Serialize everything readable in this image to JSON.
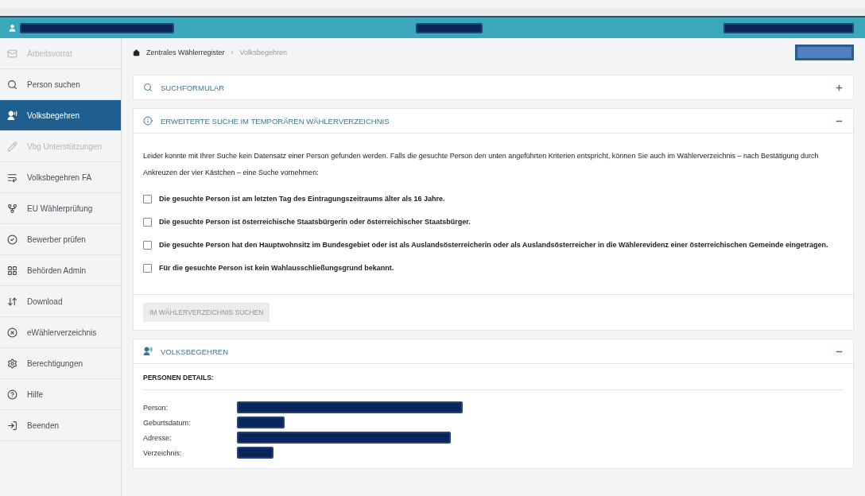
{
  "sidebar": {
    "items": [
      {
        "label": "Arbeitsvorrat",
        "selected": false,
        "disabled": true
      },
      {
        "label": "Person suchen",
        "selected": false,
        "disabled": false
      },
      {
        "label": "Volksbegehren",
        "selected": true,
        "disabled": false
      },
      {
        "label": "Vbg Unterstützungen",
        "selected": false,
        "disabled": true
      },
      {
        "label": "Volksbegehren FA",
        "selected": false,
        "disabled": false
      },
      {
        "label": "EU Wählerprüfung",
        "selected": false,
        "disabled": false
      },
      {
        "label": "Bewerber prüfen",
        "selected": false,
        "disabled": false
      },
      {
        "label": "Behörden Admin",
        "selected": false,
        "disabled": false
      },
      {
        "label": "Download",
        "selected": false,
        "disabled": false
      },
      {
        "label": "eWählerverzeichnis",
        "selected": false,
        "disabled": false
      },
      {
        "label": "Berechtigungen",
        "selected": false,
        "disabled": false
      },
      {
        "label": "Hilfe",
        "selected": false,
        "disabled": false
      },
      {
        "label": "Beenden",
        "selected": false,
        "disabled": false
      }
    ]
  },
  "breadcrumb": {
    "items": [
      "Zentrales Wählerregister",
      "Volksbegehren"
    ],
    "separator": "›"
  },
  "panels": [
    {
      "kind": "search",
      "title": "SUCHFORMULAR",
      "expanded": false
    },
    {
      "kind": "criteria",
      "title": "ERWEITERTE SUCHE IM TEMPORÄREN WÄHLERVERZEICHNIS",
      "expanded": true,
      "text": "Leider konnte mit Ihrer Suche kein Datensatz einer Person gefunden werden. Falls die gesuchte Person den unten angeführten Kriterien entspricht, können Sie auch im Wählerverzeichnis – nach Bestätigung durch Ankreuzen der vier Kästchen – eine Suche vornehmen:",
      "checks": [
        {
          "label": "Die gesuchte Person ist am letzten Tag des Eintragungszeitraums älter als 16 Jahre.",
          "checked": false
        },
        {
          "label": "Die gesuchte Person ist österreichische Staatsbürgerin oder österreichischer Staatsbürger.",
          "checked": false
        },
        {
          "label": "Die gesuchte Person hat den Hauptwohnsitz im Bundesgebiet oder ist als Auslandsösterreicherin oder als Auslandsösterreicher in die Wählerevidenz einer österreichischen Gemeinde eingetragen.",
          "checked": false
        },
        {
          "label": "Für die gesuchte Person ist kein Wahlausschließungsgrund bekannt.",
          "checked": false
        }
      ],
      "button": {
        "label": "IM WÄHLERVERZEICHNIS SUCHEN",
        "disabled": true
      }
    },
    {
      "kind": "details",
      "title": "VOLKSBEGEHREN",
      "expanded": true,
      "subtitle": "PERSONEN DETAILS:",
      "fields": [
        {
          "label": "Person:"
        },
        {
          "label": "Geburtsdatum:"
        },
        {
          "label": "Adresse:"
        },
        {
          "label": "Verzeichnis:"
        }
      ]
    }
  ]
}
